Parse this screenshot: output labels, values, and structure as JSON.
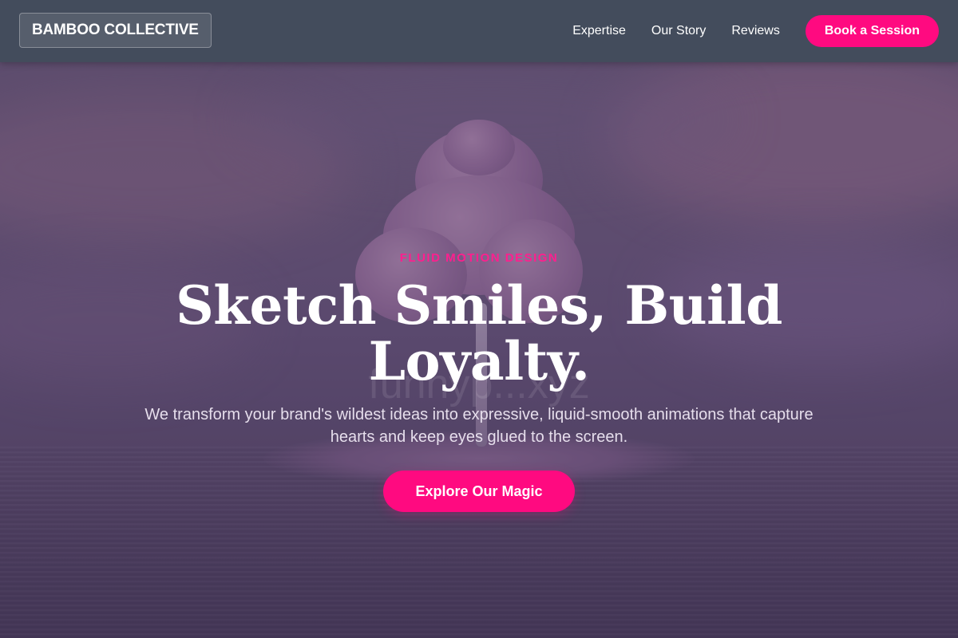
{
  "header": {
    "logo_text": "BAMBOO COLLECTIVE",
    "nav": [
      {
        "label": "Expertise"
      },
      {
        "label": "Our Story"
      },
      {
        "label": "Reviews"
      }
    ],
    "cta_label": "Book a Session"
  },
  "hero": {
    "eyebrow": "FLUID MOTION DESIGN",
    "headline": "Sketch Smiles, Build Loyalty.",
    "subheadline": "We transform your brand's wildest ideas into expressive, liquid-smooth animations that capture hearts and keep eyes glued to the screen.",
    "cta_label": "Explore Our Magic",
    "watermark": "funnyp...xyz"
  },
  "colors": {
    "accent": "#ff0a80",
    "eyebrow": "#ff1f8e",
    "header_bg": "#434c5c"
  }
}
